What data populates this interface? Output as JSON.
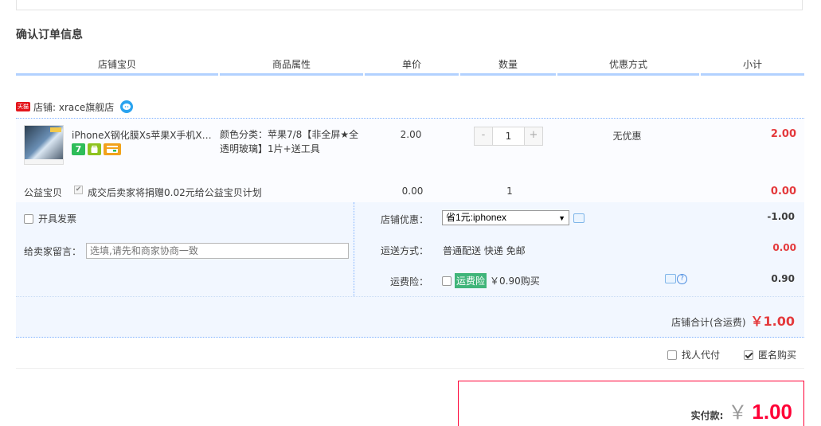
{
  "section_title": "确认订单信息",
  "columns": [
    "店铺宝贝",
    "商品属性",
    "单价",
    "数量",
    "优惠方式",
    "小计"
  ],
  "shop": {
    "badge": "天猫",
    "name": "店铺: xrace旗舰店"
  },
  "item": {
    "title": "iPhoneX钢化膜Xs苹果X手机XR全屏覆盖",
    "icon_seven": "7",
    "attributes": "颜色分类：苹果7/8【非全屏★全透明玻璃】1片+送工具",
    "unit_price": "2.00",
    "quantity": "1",
    "discount": "无优惠",
    "subtotal": "2.00",
    "qty_minus": "-",
    "qty_plus": "+"
  },
  "charity": {
    "label": "公益宝贝",
    "text": "成交后卖家将捐赠0.02元给公益宝贝计划",
    "price": "0.00",
    "qty": "1",
    "subtotal": "0.00"
  },
  "invoice": {
    "label": "开具发票"
  },
  "message": {
    "label": "给卖家留言：",
    "placeholder": "选填,请先和商家协商一致"
  },
  "shop_discount": {
    "label": "店铺优惠：",
    "selected": "省1元:iphonex",
    "value": "-1.00"
  },
  "shipping": {
    "label": "运送方式：",
    "text": "普通配送 快递 免邮",
    "value": "0.00"
  },
  "insurance": {
    "label": "运费险：",
    "badge": "运费险",
    "text": "￥0.90购买",
    "value": "0.90"
  },
  "shop_total": {
    "label": "店铺合计(含运费)",
    "value": "￥1.00"
  },
  "options": {
    "proxy_pay": "找人代付",
    "anonymous": "匿名购买"
  },
  "payment": {
    "label": "实付款:",
    "currency": "￥",
    "value": "1.00"
  },
  "colors": {
    "accent_red": "#e4393c",
    "pay_red": "#ff0036",
    "header_border": "#b2d1ff",
    "panel_bg": "#f2f7ff"
  }
}
